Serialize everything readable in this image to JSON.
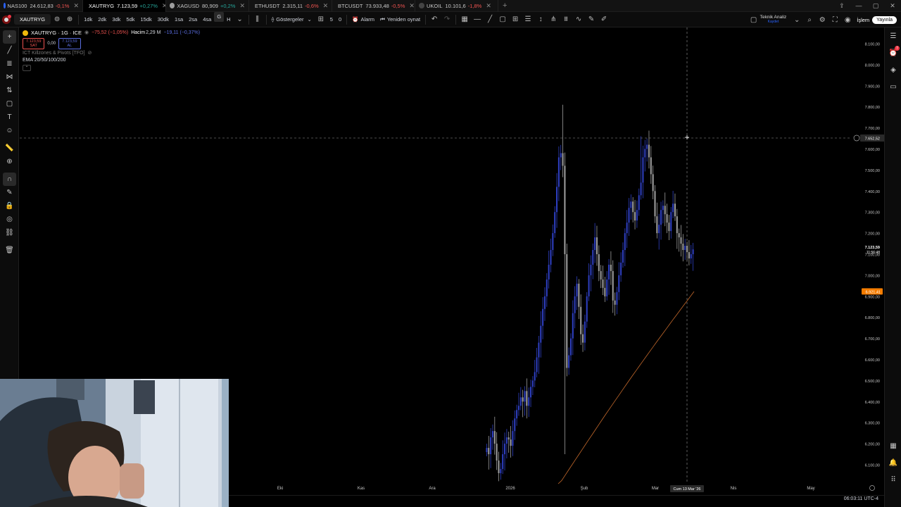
{
  "tabs": [
    {
      "symbol": "NAS100",
      "price": "24.612,83",
      "change": "-0,1%",
      "dir": "dn",
      "color": "#2962ff"
    },
    {
      "symbol": "XAUTRYG",
      "price": "7.123,59",
      "change": "+0,27%",
      "dir": "up",
      "color": "#f0b90b",
      "active": true
    },
    {
      "symbol": "XAGUSD",
      "price": "80,909",
      "change": "+0,2%",
      "dir": "up",
      "color": "#9e9e9e"
    },
    {
      "symbol": "ETHUSDT",
      "price": "2.315,11",
      "change": "-0,6%",
      "dir": "dn",
      "color": "#627eea"
    },
    {
      "symbol": "BTCUSDT",
      "price": "73.933,48",
      "change": "-0,5%",
      "dir": "dn",
      "color": "#f7931a"
    },
    {
      "symbol": "UKOIL",
      "price": "10.101,6",
      "change": "-1,8%",
      "dir": "dn",
      "color": "#444444"
    }
  ],
  "toolbar": {
    "symbol": "XAUTRYG",
    "intervals": [
      "1dk",
      "2dk",
      "3dk",
      "5dk",
      "15dk",
      "30dk",
      "1sa",
      "2sa",
      "4sa",
      "G",
      "H"
    ],
    "indicators_label": "Göstergeler",
    "alarm_label": "Alarm",
    "replay_label": "Yeniden oynat",
    "tech_analysis_label": "Teknik Analiz",
    "tech_analysis_sub": "Kaydet",
    "trade_label": "İşlem",
    "publish_label": "Yayınla",
    "count_a": "5",
    "count_b": "0"
  },
  "legend": {
    "title": "XAUTRYG · 1G · ICE",
    "change": "−75,52 (−1,05%)",
    "volume_label": "Hacim",
    "volume": "2,29 M",
    "volume_change": "−19,11 (−0,37%)",
    "sell_price": "7.123,59",
    "sell_label": "SAT",
    "spread": "0,00",
    "buy_price": "7.123,59",
    "buy_label": "AL",
    "indicator1": "ICT Killzones & Pivots [TFO]",
    "indicator2": "EMA 20/50/100/200"
  },
  "chart_data": {
    "type": "candlestick",
    "symbol": "XAUTRYG",
    "price_axis": [
      "8.100,00",
      "8.000,00",
      "7.900,00",
      "7.800,00",
      "7.700,00",
      "7.600,00",
      "7.500,00",
      "7.400,00",
      "7.300,00",
      "7.200,00",
      "7.100,00",
      "7.000,00",
      "6.900,00",
      "6.800,00",
      "6.700,00",
      "6.600,00",
      "6.500,00",
      "6.400,00",
      "6.300,00",
      "6.200,00",
      "6.100,00"
    ],
    "time_axis": [
      "Eki",
      "Kas",
      "Ara",
      "2026",
      "Şub",
      "Mar",
      "Nis",
      "May"
    ],
    "crosshair_price": "7.652,52",
    "crosshair_time": "Cum 13 Mar '26",
    "last_price": "7.123,59",
    "countdown": "11:56:48",
    "ema_price": "6.921,41",
    "ylim": [
      6050,
      8150
    ],
    "colors": {
      "up": "#2e3fc2",
      "down": "#9e9e9e",
      "ema": "#c4692b",
      "last": "#f57c00"
    }
  },
  "footer": {
    "clock": "06:03:11 UTC-4"
  }
}
